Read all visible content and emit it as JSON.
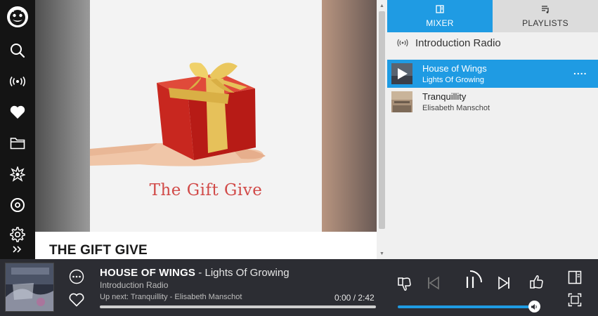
{
  "nav": {
    "items": [
      {
        "icon": "napster-logo-icon"
      },
      {
        "icon": "search-icon"
      },
      {
        "icon": "radio-icon"
      },
      {
        "icon": "heart-icon"
      },
      {
        "icon": "folder-icon"
      },
      {
        "icon": "star-burst-icon"
      },
      {
        "icon": "vinyl-icon"
      },
      {
        "icon": "gear-icon"
      },
      {
        "icon": "expand-chevrons-icon"
      }
    ]
  },
  "main": {
    "cover_text": "The Gift Give",
    "album_title": "THE GIFT GIVE"
  },
  "right_panel": {
    "tabs": [
      {
        "label": "MIXER",
        "icon": "mixer-icon",
        "active": true
      },
      {
        "label": "PLAYLISTS",
        "icon": "playlist-icon",
        "active": false
      }
    ],
    "station": "Introduction Radio",
    "tracks": [
      {
        "title": "House of Wings",
        "artist": "Lights Of Growing",
        "active": true,
        "more": "...."
      },
      {
        "title": "Tranquillity",
        "artist": "Elisabeth Manschot",
        "active": false
      }
    ]
  },
  "player": {
    "song": "HOUSE OF WINGS",
    "separator": " - ",
    "artist": "Lights Of Growing",
    "station": "Introduction Radio",
    "up_next": "Up next: Tranquillity - Elisabeth Manschot",
    "time": "0:00 / 2:42",
    "progress": 0,
    "volume": 1.0
  },
  "colors": {
    "accent": "#1f9be3",
    "nav_bg": "#141414",
    "player_bg": "#2c2d33",
    "cover_text": "#d14a48"
  }
}
